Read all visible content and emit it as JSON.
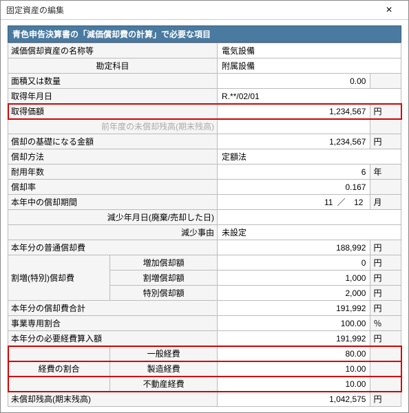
{
  "window": {
    "title": "固定資産の編集",
    "close": "×"
  },
  "section": {
    "head": "青色申告決算書の「減価償却費の計算」で必要な項目"
  },
  "rows": {
    "name": {
      "label": "減価償却資産の名称等",
      "value": "電気設備"
    },
    "account": {
      "label": "勘定科目",
      "value": "附属設備"
    },
    "area": {
      "label": "面積又は数量",
      "value": "0.00"
    },
    "acq_date": {
      "label": "取得年月日",
      "value": "R.**/02/01"
    },
    "acq_price": {
      "label": "取得価額",
      "value": "1,234,567",
      "unit": "円"
    },
    "prev_bal": {
      "label": "前年度の未償却残高(期末残高)"
    },
    "base": {
      "label": "償却の基礎になる金額",
      "value": "1,234,567",
      "unit": "円"
    },
    "method": {
      "label": "償却方法",
      "value": "定額法"
    },
    "life": {
      "label": "耐用年数",
      "value": "6",
      "unit": "年"
    },
    "rate": {
      "label": "償却率",
      "value": "0.167"
    },
    "period": {
      "label": "本年中の償却期間",
      "m1": "11",
      "sep": "／",
      "m2": "12",
      "unit": "月"
    },
    "dec_date": {
      "label": "減少年月日(廃棄/売却した日)"
    },
    "dec_reason": {
      "label": "減少事由",
      "value": "未設定"
    },
    "ordinary": {
      "label": "本年分の普通償却費",
      "value": "188,992",
      "unit": "円"
    },
    "special_grp": {
      "label": "割増(特別)償却費"
    },
    "sp_inc": {
      "label": "増加償却額",
      "value": "0",
      "unit": "円"
    },
    "sp_extra": {
      "label": "割増償却額",
      "value": "1,000",
      "unit": "円"
    },
    "sp_special": {
      "label": "特別償却額",
      "value": "2,000",
      "unit": "円"
    },
    "total": {
      "label": "本年分の償却費合計",
      "value": "191,992",
      "unit": "円"
    },
    "biz_ratio": {
      "label": "事業専用割合",
      "value": "100.00",
      "unit": "％"
    },
    "necessary": {
      "label": "本年分の必要経費算入額",
      "value": "191,992",
      "unit": "円"
    },
    "ratio_grp": {
      "label": "経費の割合"
    },
    "r_general": {
      "label": "一般経費",
      "value": "80.00"
    },
    "r_mfg": {
      "label": "製造経費",
      "value": "10.00"
    },
    "r_realest": {
      "label": "不動産経費",
      "value": "10.00"
    },
    "remain": {
      "label": "未償却残高(期末残高)",
      "value": "1,042,575",
      "unit": "円"
    }
  }
}
